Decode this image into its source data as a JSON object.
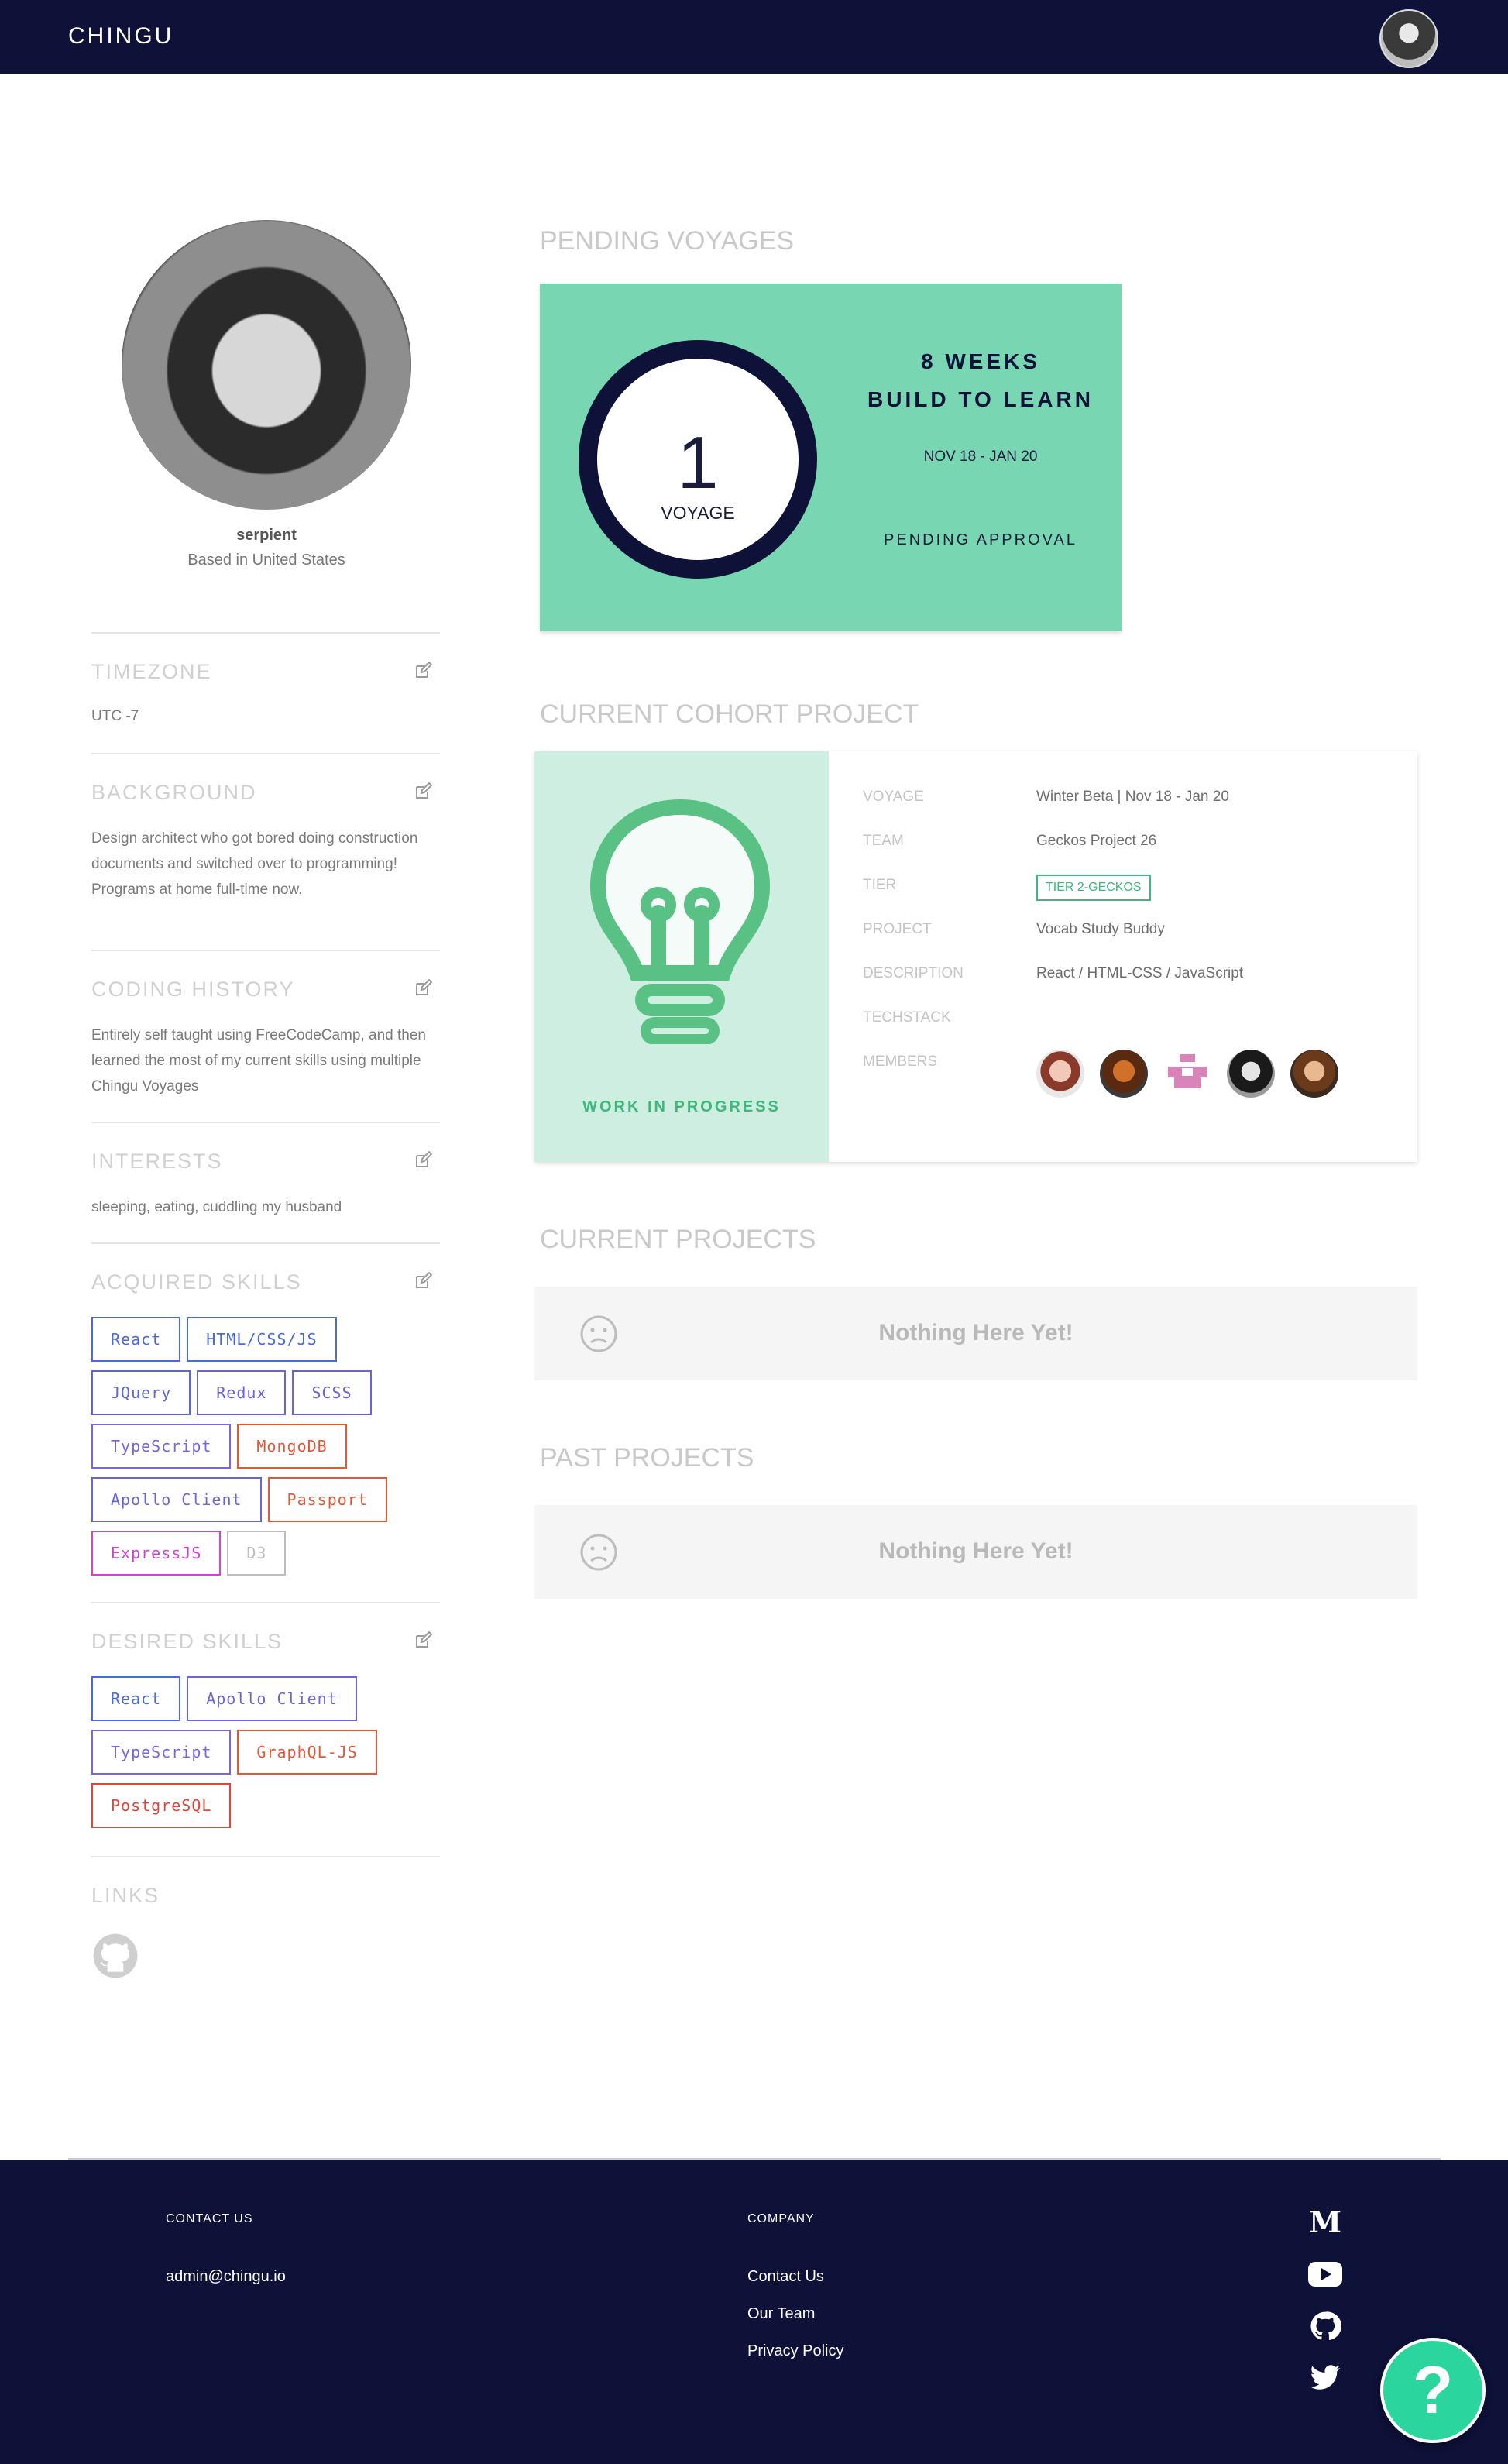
{
  "header": {
    "brand": "CHINGU"
  },
  "profile": {
    "username": "serpient",
    "location": "Based in United States"
  },
  "sidebar": {
    "timezone": {
      "title": "TIMEZONE",
      "text": "UTC -7"
    },
    "background": {
      "title": "BACKGROUND",
      "text": "Design architect who got bored doing construction documents and switched over to programming! Programs at home full-time now."
    },
    "coding_history": {
      "title": "CODING HISTORY",
      "text": "Entirely self taught using FreeCodeCamp, and then learned the most of my current skills using multiple Chingu Voyages"
    },
    "interests": {
      "title": "INTERESTS",
      "text": "sleeping, eating, cuddling my husband"
    },
    "acquired_skills": {
      "title": "ACQUIRED SKILLS",
      "items": [
        {
          "label": "React",
          "color": "#4a6ad8"
        },
        {
          "label": "HTML/CSS/JS",
          "color": "#4a6ad8"
        },
        {
          "label": "JQuery",
          "color": "#5d66d8"
        },
        {
          "label": "Redux",
          "color": "#6a62d8"
        },
        {
          "label": "SCSS",
          "color": "#6a62d8"
        },
        {
          "label": "TypeScript",
          "color": "#7a66d8"
        },
        {
          "label": "MongoDB",
          "color": "#e05a3a"
        },
        {
          "label": "Apollo Client",
          "color": "#6a66d8"
        },
        {
          "label": "Passport",
          "color": "#e05a3a"
        },
        {
          "label": "ExpressJS",
          "color": "#d642d0"
        },
        {
          "label": "D3",
          "color": "#bdbdbd"
        }
      ]
    },
    "desired_skills": {
      "title": "DESIRED SKILLS",
      "items": [
        {
          "label": "React",
          "color": "#4a6ad8"
        },
        {
          "label": "Apollo Client",
          "color": "#6a66d8"
        },
        {
          "label": "TypeScript",
          "color": "#7a66d8"
        },
        {
          "label": "GraphQL-JS",
          "color": "#e05a3a"
        },
        {
          "label": "PostgreSQL",
          "color": "#e0453a"
        }
      ]
    },
    "links": {
      "title": "LINKS"
    }
  },
  "main": {
    "pending": {
      "title": "PENDING VOYAGES",
      "count": "1",
      "count_label": "VOYAGE",
      "line1": "8 WEEKS",
      "line2": "BUILD TO LEARN",
      "dates": "NOV 18 - JAN 20",
      "status": "PENDING APPROVAL"
    },
    "cohort": {
      "title": "CURRENT COHORT PROJECT",
      "badge": "WORK IN PROGRESS",
      "labels": {
        "voyage": "VOYAGE",
        "team": "TEAM",
        "tier": "TIER",
        "project": "PROJECT",
        "description": "DESCRIPTION",
        "techstack": "TECHSTACK",
        "members": "MEMBERS"
      },
      "voyage": "Winter Beta | Nov 18 - Jan 20",
      "team": "Geckos Project 26",
      "tier": "TIER 2-GECKOS",
      "project": "Vocab Study Buddy",
      "description": "React / HTML-CSS / JavaScript"
    },
    "current_projects": {
      "title": "CURRENT PROJECTS",
      "empty": "Nothing Here Yet!"
    },
    "past_projects": {
      "title": "PAST PROJECTS",
      "empty": "Nothing Here Yet!"
    }
  },
  "footer": {
    "contact_heading": "CONTACT US",
    "email": "admin@chingu.io",
    "company_heading": "COMPANY",
    "company_links": [
      "Contact Us",
      "Our Team",
      "Privacy Policy"
    ],
    "social_icons": [
      "medium-icon",
      "youtube-icon",
      "github-icon",
      "twitter-icon"
    ],
    "help": "?"
  },
  "colors": {
    "navy": "#0e1138",
    "mint": "#78d6b2",
    "green": "#3db87f"
  }
}
